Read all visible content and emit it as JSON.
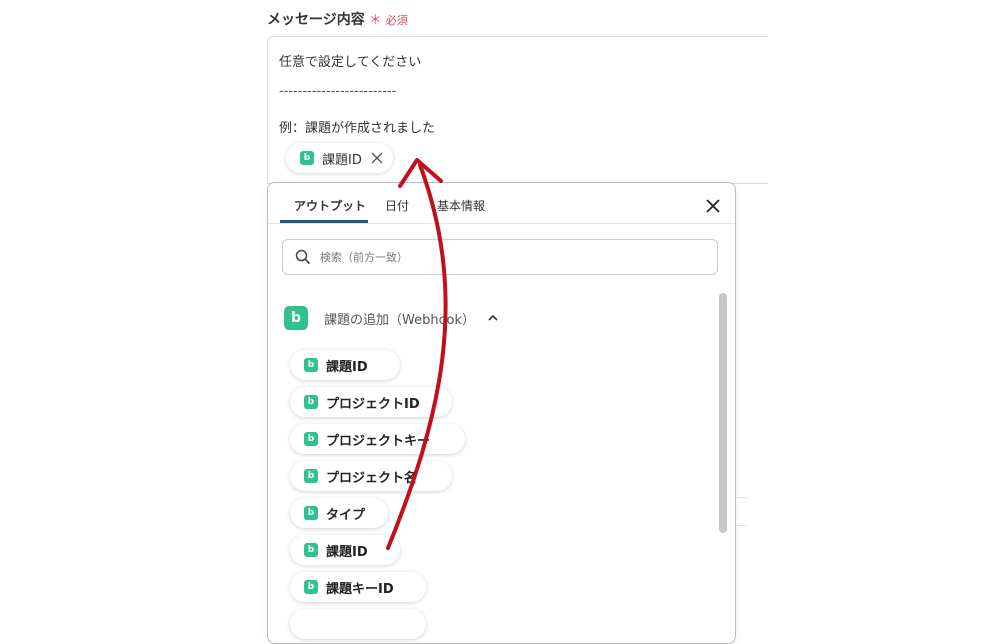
{
  "field": {
    "label": "メッセージ内容",
    "required_mark": "＊",
    "required": "必須"
  },
  "textarea": {
    "lines": [
      "任意で設定してください",
      "-------------------------",
      "例：課題が作成されました"
    ],
    "chip": "課題ID"
  },
  "panel": {
    "tabs": [
      "アウトプット",
      "日付",
      "基本情報"
    ],
    "search_placeholder": "検索（前方一致）",
    "group_title": "課題の追加（Webhook）",
    "items": [
      "課題ID",
      "プロジェクトID",
      "プロジェクトキー",
      "プロジェクト名",
      "タイプ",
      "課題ID",
      "課題キーID"
    ]
  },
  "logo_letter": "b",
  "colors": {
    "accent": "#2fc28c",
    "tab_underline": "#1f5a7a",
    "required": "#e04b5a",
    "arrow": "#c0101c"
  }
}
